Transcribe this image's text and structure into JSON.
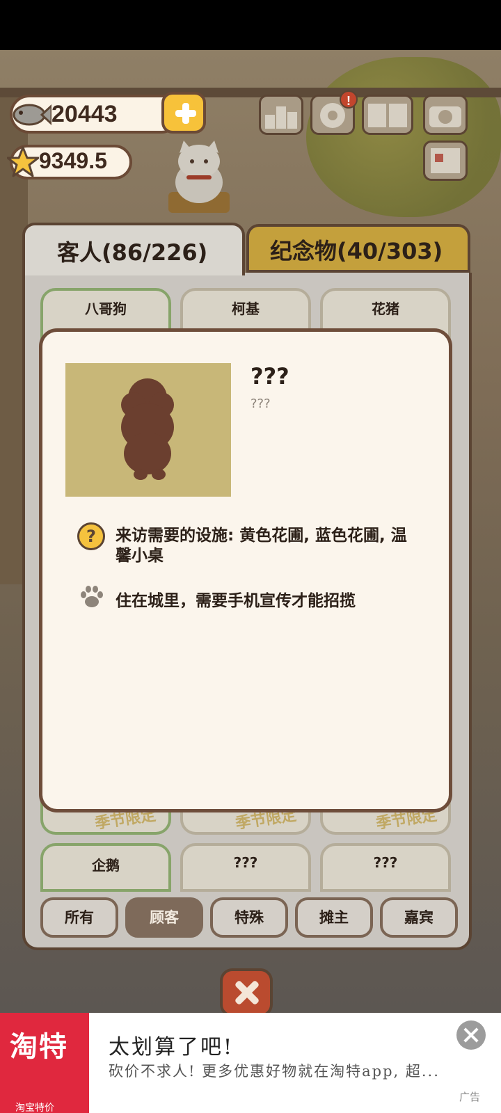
{
  "currency": {
    "fish": "20443",
    "stars": "9349.5"
  },
  "tabs": [
    {
      "label": "客人(86/226)",
      "active": true
    },
    {
      "label": "纪念物(40/303)",
      "active": false
    }
  ],
  "guest_cards_top": [
    "八哥狗",
    "柯基",
    "花猪"
  ],
  "guest_cards_bottom": [
    "企鹅",
    "???",
    "???"
  ],
  "season_limited_label": "季节限定",
  "filters": [
    {
      "label": "所有",
      "active": false
    },
    {
      "label": "顾客",
      "active": true
    },
    {
      "label": "特殊",
      "active": false
    },
    {
      "label": "摊主",
      "active": false
    },
    {
      "label": "嘉宾",
      "active": false
    }
  ],
  "detail": {
    "name": "???",
    "subtitle": "???",
    "requirement": "来访需要的设施: 黄色花圃, 蓝色花圃, 温馨小桌",
    "habitat": "住在城里，需要手机宣传才能招揽"
  },
  "ad": {
    "logo": "淘特",
    "logo_sub": "淘宝特价",
    "title": "太划算了吧!",
    "description": "砍价不求人! 更多优惠好物就在淘特app, 超...",
    "tag": "广告"
  },
  "colors": {
    "accent_yellow": "#f7c23a",
    "tab_gold": "#c4a03c",
    "close_red": "#ba4b2f",
    "ad_red": "#e0283e"
  }
}
